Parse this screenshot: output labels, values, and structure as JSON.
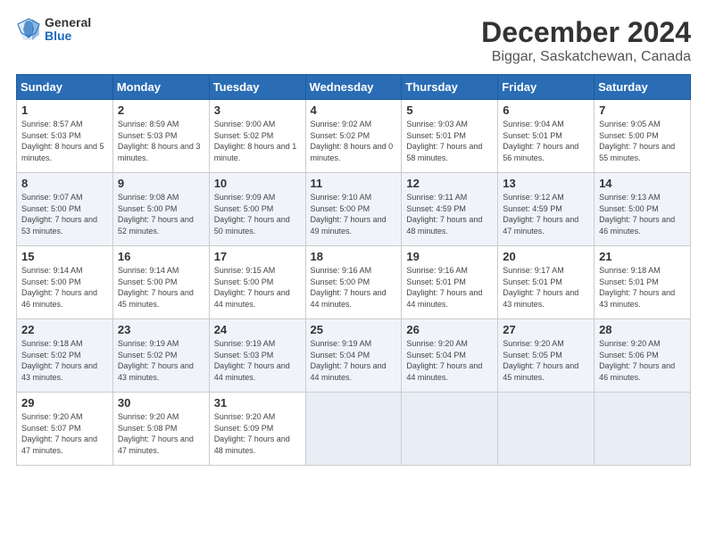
{
  "logo": {
    "general": "General",
    "blue": "Blue"
  },
  "title": "December 2024",
  "subtitle": "Biggar, Saskatchewan, Canada",
  "days_of_week": [
    "Sunday",
    "Monday",
    "Tuesday",
    "Wednesday",
    "Thursday",
    "Friday",
    "Saturday"
  ],
  "weeks": [
    [
      {
        "day": "1",
        "sunrise": "8:57 AM",
        "sunset": "5:03 PM",
        "daylight": "8 hours and 5 minutes."
      },
      {
        "day": "2",
        "sunrise": "8:59 AM",
        "sunset": "5:03 PM",
        "daylight": "8 hours and 3 minutes."
      },
      {
        "day": "3",
        "sunrise": "9:00 AM",
        "sunset": "5:02 PM",
        "daylight": "8 hours and 1 minute."
      },
      {
        "day": "4",
        "sunrise": "9:02 AM",
        "sunset": "5:02 PM",
        "daylight": "8 hours and 0 minutes."
      },
      {
        "day": "5",
        "sunrise": "9:03 AM",
        "sunset": "5:01 PM",
        "daylight": "7 hours and 58 minutes."
      },
      {
        "day": "6",
        "sunrise": "9:04 AM",
        "sunset": "5:01 PM",
        "daylight": "7 hours and 56 minutes."
      },
      {
        "day": "7",
        "sunrise": "9:05 AM",
        "sunset": "5:00 PM",
        "daylight": "7 hours and 55 minutes."
      }
    ],
    [
      {
        "day": "8",
        "sunrise": "9:07 AM",
        "sunset": "5:00 PM",
        "daylight": "7 hours and 53 minutes."
      },
      {
        "day": "9",
        "sunrise": "9:08 AM",
        "sunset": "5:00 PM",
        "daylight": "7 hours and 52 minutes."
      },
      {
        "day": "10",
        "sunrise": "9:09 AM",
        "sunset": "5:00 PM",
        "daylight": "7 hours and 50 minutes."
      },
      {
        "day": "11",
        "sunrise": "9:10 AM",
        "sunset": "5:00 PM",
        "daylight": "7 hours and 49 minutes."
      },
      {
        "day": "12",
        "sunrise": "9:11 AM",
        "sunset": "4:59 PM",
        "daylight": "7 hours and 48 minutes."
      },
      {
        "day": "13",
        "sunrise": "9:12 AM",
        "sunset": "4:59 PM",
        "daylight": "7 hours and 47 minutes."
      },
      {
        "day": "14",
        "sunrise": "9:13 AM",
        "sunset": "5:00 PM",
        "daylight": "7 hours and 46 minutes."
      }
    ],
    [
      {
        "day": "15",
        "sunrise": "9:14 AM",
        "sunset": "5:00 PM",
        "daylight": "7 hours and 46 minutes."
      },
      {
        "day": "16",
        "sunrise": "9:14 AM",
        "sunset": "5:00 PM",
        "daylight": "7 hours and 45 minutes."
      },
      {
        "day": "17",
        "sunrise": "9:15 AM",
        "sunset": "5:00 PM",
        "daylight": "7 hours and 44 minutes."
      },
      {
        "day": "18",
        "sunrise": "9:16 AM",
        "sunset": "5:00 PM",
        "daylight": "7 hours and 44 minutes."
      },
      {
        "day": "19",
        "sunrise": "9:16 AM",
        "sunset": "5:01 PM",
        "daylight": "7 hours and 44 minutes."
      },
      {
        "day": "20",
        "sunrise": "9:17 AM",
        "sunset": "5:01 PM",
        "daylight": "7 hours and 43 minutes."
      },
      {
        "day": "21",
        "sunrise": "9:18 AM",
        "sunset": "5:01 PM",
        "daylight": "7 hours and 43 minutes."
      }
    ],
    [
      {
        "day": "22",
        "sunrise": "9:18 AM",
        "sunset": "5:02 PM",
        "daylight": "7 hours and 43 minutes."
      },
      {
        "day": "23",
        "sunrise": "9:19 AM",
        "sunset": "5:02 PM",
        "daylight": "7 hours and 43 minutes."
      },
      {
        "day": "24",
        "sunrise": "9:19 AM",
        "sunset": "5:03 PM",
        "daylight": "7 hours and 44 minutes."
      },
      {
        "day": "25",
        "sunrise": "9:19 AM",
        "sunset": "5:04 PM",
        "daylight": "7 hours and 44 minutes."
      },
      {
        "day": "26",
        "sunrise": "9:20 AM",
        "sunset": "5:04 PM",
        "daylight": "7 hours and 44 minutes."
      },
      {
        "day": "27",
        "sunrise": "9:20 AM",
        "sunset": "5:05 PM",
        "daylight": "7 hours and 45 minutes."
      },
      {
        "day": "28",
        "sunrise": "9:20 AM",
        "sunset": "5:06 PM",
        "daylight": "7 hours and 46 minutes."
      }
    ],
    [
      {
        "day": "29",
        "sunrise": "9:20 AM",
        "sunset": "5:07 PM",
        "daylight": "7 hours and 47 minutes."
      },
      {
        "day": "30",
        "sunrise": "9:20 AM",
        "sunset": "5:08 PM",
        "daylight": "7 hours and 47 minutes."
      },
      {
        "day": "31",
        "sunrise": "9:20 AM",
        "sunset": "5:09 PM",
        "daylight": "7 hours and 48 minutes."
      },
      null,
      null,
      null,
      null
    ]
  ]
}
